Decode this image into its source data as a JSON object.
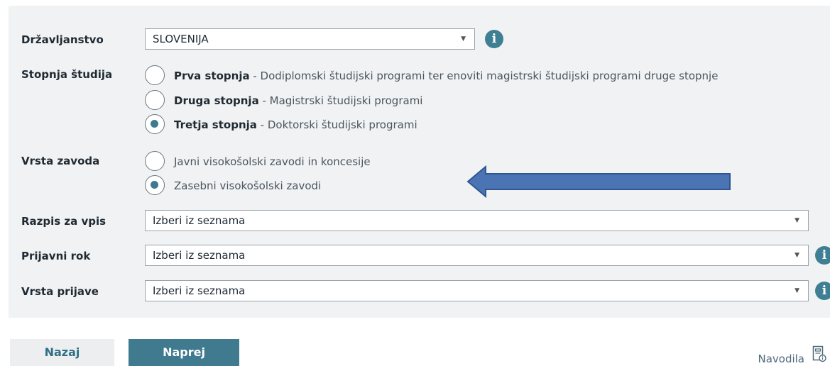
{
  "form": {
    "citizenship": {
      "label": "Državljanstvo",
      "value": "SLOVENIJA"
    },
    "study_level": {
      "label": "Stopnja študija",
      "options": [
        {
          "title": "Prva stopnja",
          "desc": " - Dodiplomski študijski programi ter enoviti magistrski študijski programi druge stopnje",
          "selected": false
        },
        {
          "title": "Druga stopnja",
          "desc": " - Magistrski študijski programi",
          "selected": false
        },
        {
          "title": "Tretja stopnja",
          "desc": " - Doktorski študijski programi",
          "selected": true
        }
      ]
    },
    "institution_type": {
      "label": "Vrsta zavoda",
      "options": [
        {
          "text": "Javni visokošolski zavodi in koncesije",
          "selected": false
        },
        {
          "text": "Zasebni visokošolski zavodi",
          "selected": true
        }
      ]
    },
    "call": {
      "label": "Razpis za vpis",
      "value": "Izberi iz seznama"
    },
    "deadline": {
      "label": "Prijavni rok",
      "value": "Izberi iz seznama"
    },
    "application_type": {
      "label": "Vrsta prijave",
      "value": "Izberi iz seznama"
    }
  },
  "buttons": {
    "back": "Nazaj",
    "next": "Naprej"
  },
  "help": {
    "label": "Navodila"
  },
  "icons": {
    "info": "info-icon",
    "dropdown": "chevron-down-icon",
    "help": "document-help-icon",
    "annotation": "arrow-left-annotation"
  },
  "colors": {
    "accent": "#3f7a8e",
    "arrow_fill": "#4a74b4",
    "panel_bg": "#f1f2f3"
  }
}
